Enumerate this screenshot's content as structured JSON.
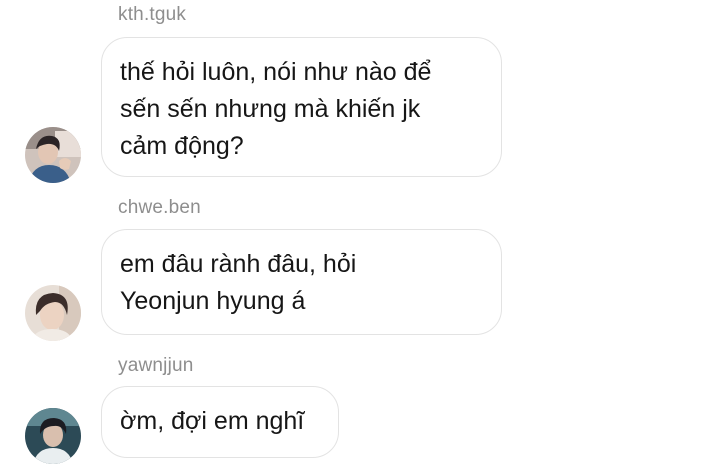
{
  "messages": [
    {
      "username": "kth.tguk",
      "lines": [
        "thế hỏi luôn, nói như nào để",
        "sến sến nhưng mà khiến jk",
        "cảm động?"
      ]
    },
    {
      "username": "chwe.ben",
      "lines": [
        "em đâu rành đâu, hỏi",
        "Yeonjun hyung á"
      ]
    },
    {
      "username": "yawnjjun",
      "lines": [
        "ờm, đợi em nghĩ"
      ]
    }
  ],
  "colors": {
    "username": "#8e8e8e",
    "bubble_border": "#e3e3e3",
    "text": "#161616",
    "background": "#ffffff"
  }
}
